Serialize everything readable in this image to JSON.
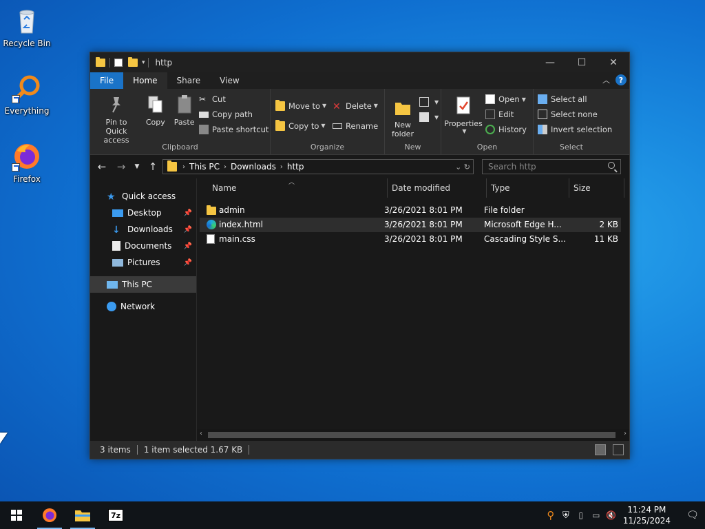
{
  "desktop": {
    "icons": [
      {
        "label": "Recycle Bin"
      },
      {
        "label": "Everything"
      },
      {
        "label": "Firefox"
      }
    ]
  },
  "window": {
    "title": "http",
    "tabs": [
      "File",
      "Home",
      "Share",
      "View"
    ],
    "ribbon": {
      "clipboard": {
        "group": "Clipboard",
        "pin": "Pin to Quick access",
        "copy": "Copy",
        "paste": "Paste",
        "cut": "Cut",
        "copy_path": "Copy path",
        "paste_shortcut": "Paste shortcut"
      },
      "organize": {
        "group": "Organize",
        "move_to": "Move to",
        "copy_to": "Copy to",
        "delete": "Delete",
        "rename": "Rename"
      },
      "new": {
        "group": "New",
        "new_folder": "New folder"
      },
      "open": {
        "group": "Open",
        "properties": "Properties",
        "open": "Open",
        "edit": "Edit",
        "history": "History"
      },
      "select": {
        "group": "Select",
        "select_all": "Select all",
        "select_none": "Select none",
        "invert": "Invert selection"
      }
    },
    "address": {
      "crumbs": [
        "This PC",
        "Downloads",
        "http"
      ],
      "search_placeholder": "Search http"
    },
    "nav": {
      "quick_access": "Quick access",
      "desktop": "Desktop",
      "downloads": "Downloads",
      "documents": "Documents",
      "pictures": "Pictures",
      "this_pc": "This PC",
      "network": "Network"
    },
    "columns": {
      "name": "Name",
      "date": "Date modified",
      "type": "Type",
      "size": "Size"
    },
    "files": [
      {
        "name": "admin",
        "date": "3/26/2021 8:01 PM",
        "type": "File folder",
        "size": ""
      },
      {
        "name": "index.html",
        "date": "3/26/2021 8:01 PM",
        "type": "Microsoft Edge H...",
        "size": "2 KB"
      },
      {
        "name": "main.css",
        "date": "3/26/2021 8:01 PM",
        "type": "Cascading Style S...",
        "size": "11 KB"
      }
    ],
    "status": {
      "items": "3 items",
      "selected": "1 item selected  1.67 KB"
    }
  },
  "taskbar": {
    "time": "11:24 PM",
    "date": "11/25/2024"
  },
  "colors": {
    "accent": "#1a73c8",
    "folder": "#f5c542"
  }
}
